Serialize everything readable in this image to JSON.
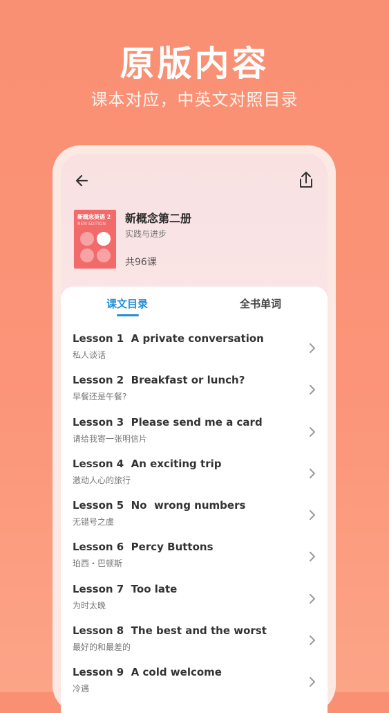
{
  "hero": {
    "title": "原版内容",
    "subtitle": "课本对应，中英文对照目录"
  },
  "book": {
    "cover_title": "新概念英语 2",
    "cover_subtitle": "NEW EDITION",
    "title": "新概念第二册",
    "subtitle": "实践与进步",
    "count": "共96课"
  },
  "tabs": {
    "toc": "课文目录",
    "words": "全书单词"
  },
  "lessons": [
    {
      "title": "Lesson 1  A private conversation",
      "zh": "私人谈话"
    },
    {
      "title": "Lesson 2  Breakfast or lunch?",
      "zh": "早餐还是午餐?"
    },
    {
      "title": "Lesson 3  Please send me a card",
      "zh": "请给我寄一张明信片"
    },
    {
      "title": "Lesson 4  An exciting trip",
      "zh": "激动人心的旅行"
    },
    {
      "title": "Lesson 5  No  wrong numbers",
      "zh": "无错号之虞"
    },
    {
      "title": "Lesson 6  Percy Buttons",
      "zh": "珀西・巴顿斯"
    },
    {
      "title": "Lesson 7  Too late",
      "zh": "为时太晚"
    },
    {
      "title": "Lesson 8  The best and the worst",
      "zh": "最好的和最差的"
    },
    {
      "title": "Lesson 9  A cold welcome",
      "zh": "冷遇"
    }
  ],
  "icons": {
    "back": "arrow-left-icon",
    "share": "share-icon",
    "chevron": "chevron-right-icon"
  },
  "colors": {
    "background": "#f98f73",
    "accent": "#1f8fd6",
    "cover": "#f36a6a"
  }
}
